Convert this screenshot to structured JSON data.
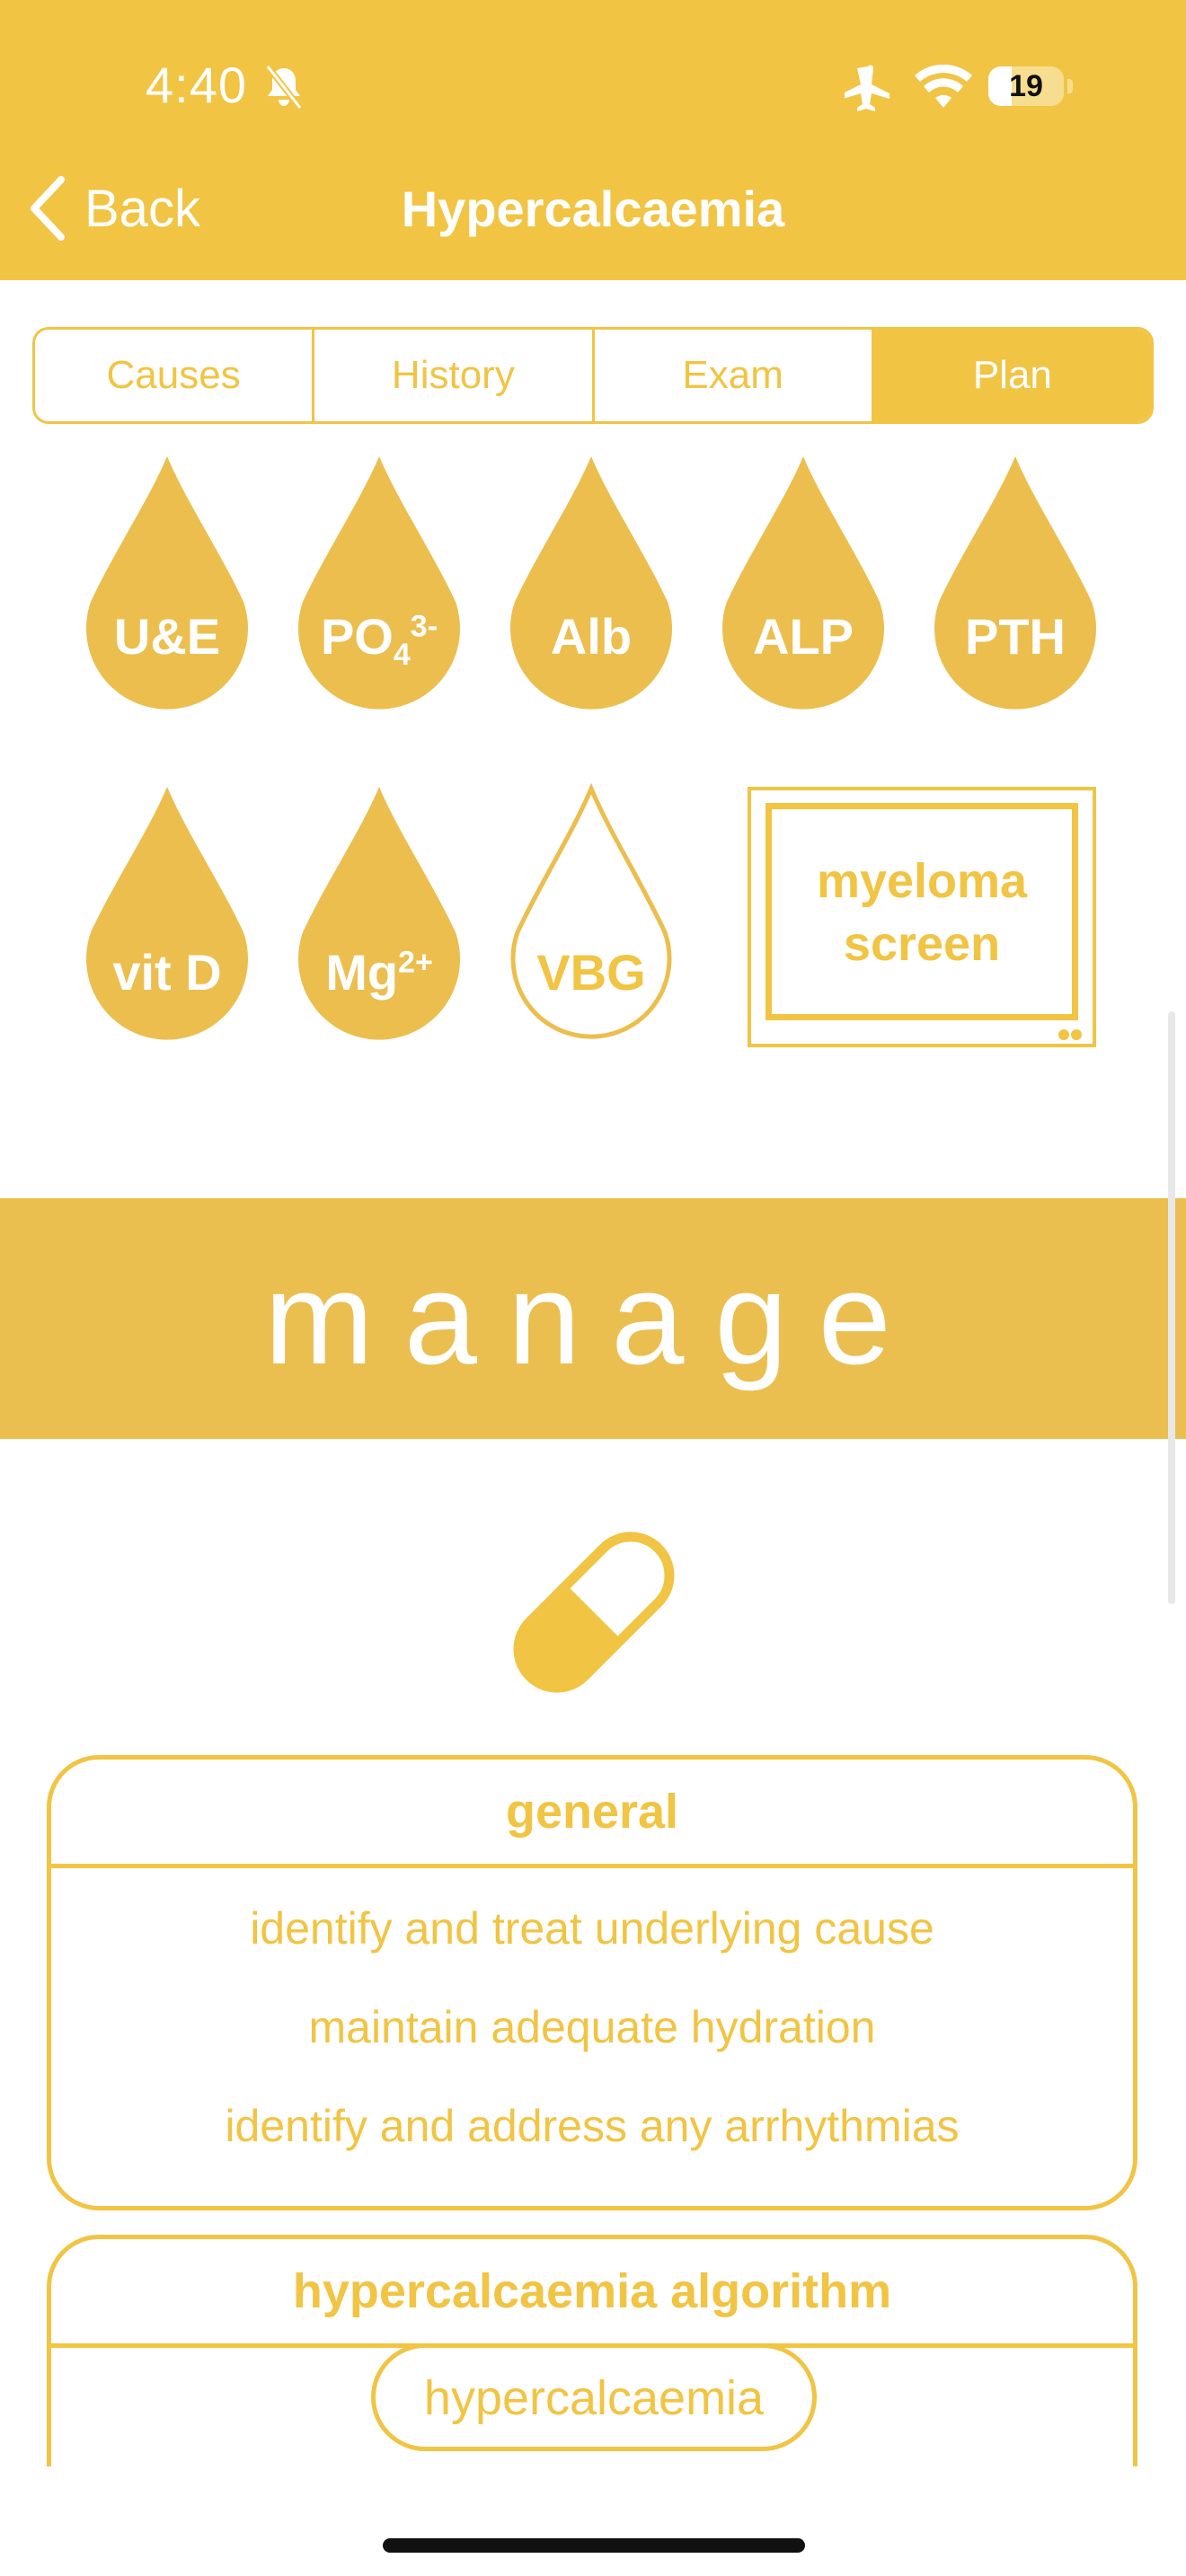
{
  "status": {
    "time": "4:40",
    "battery": "19"
  },
  "nav": {
    "back_label": "Back",
    "title": "Hypercalcaemia"
  },
  "tabs": [
    {
      "label": "Causes",
      "active": false
    },
    {
      "label": "History",
      "active": false
    },
    {
      "label": "Exam",
      "active": false
    },
    {
      "label": "Plan",
      "active": true
    }
  ],
  "tests": {
    "ue": "U&E",
    "po4_main": "PO",
    "po4_sub": "4",
    "po4_sup": "3-",
    "alb": "Alb",
    "alp": "ALP",
    "pth": "PTH",
    "vitd": "vit D",
    "mg_main": "Mg",
    "mg_sup": "2+",
    "vbg": "VBG",
    "myeloma_line1": "myeloma",
    "myeloma_line2": "screen"
  },
  "manage": {
    "heading": "manage"
  },
  "general_card": {
    "title": "general",
    "items": [
      "identify and treat underlying cause",
      "maintain adequate hydration",
      "identify and address any arrhythmias"
    ]
  },
  "algorithm_card": {
    "title": "hypercalcaemia algorithm",
    "first_node": "hypercalcaemia"
  },
  "colors": {
    "accent": "#f1c443",
    "banner": "#eabf50",
    "white": "#ffffff"
  },
  "icons": [
    "bell-slash-icon",
    "airplane-icon",
    "wifi-icon",
    "battery-icon",
    "chevron-left-icon",
    "blood-drop-icon",
    "tv-icon",
    "pill-icon"
  ]
}
